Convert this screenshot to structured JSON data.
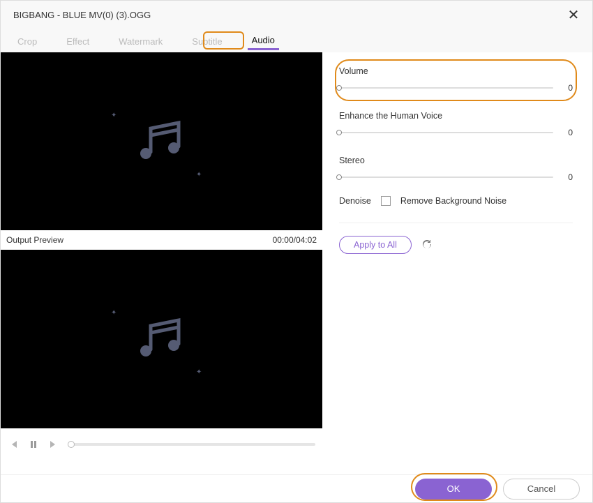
{
  "titlebar": {
    "title": "BIGBANG - BLUE MV(0) (3).OGG"
  },
  "tabs": {
    "crop": "Crop",
    "effect": "Effect",
    "watermark": "Watermark",
    "subtitle": "Subtitle",
    "audio": "Audio"
  },
  "preview": {
    "label": "Output Preview",
    "time": "00:00/04:02"
  },
  "settings": {
    "volume": {
      "label": "Volume",
      "value": "0"
    },
    "enhance": {
      "label": "Enhance the Human Voice",
      "value": "0"
    },
    "stereo": {
      "label": "Stereo",
      "value": "0"
    },
    "denoise": {
      "label": "Denoise",
      "checkbox_label": "Remove Background Noise"
    }
  },
  "buttons": {
    "apply_all": "Apply to All",
    "ok": "OK",
    "cancel": "Cancel"
  }
}
